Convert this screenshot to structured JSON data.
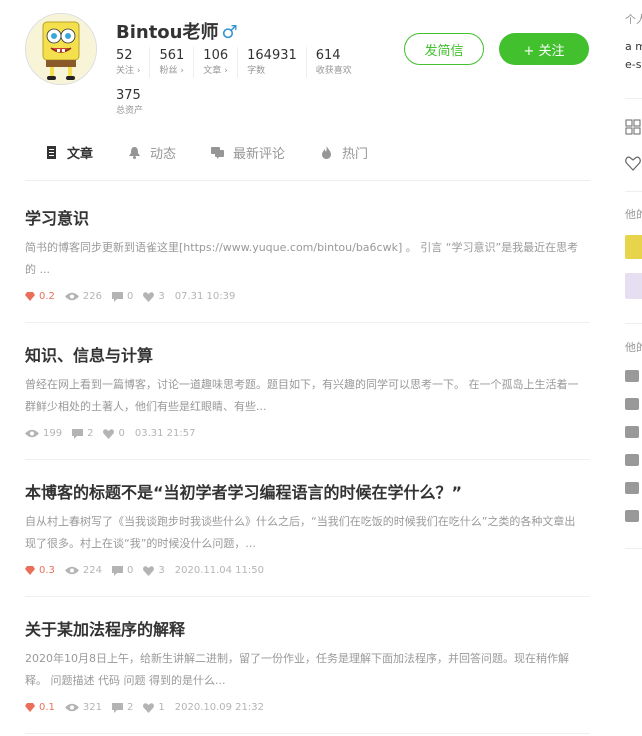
{
  "profile": {
    "name": "Bintou老师",
    "gender_icon": "♂",
    "stats": [
      {
        "num": "52",
        "label": "关注 ›"
      },
      {
        "num": "561",
        "label": "粉丝 ›"
      },
      {
        "num": "106",
        "label": "文章 ›"
      },
      {
        "num": "164931",
        "label": "字数"
      },
      {
        "num": "614",
        "label": "收获喜欢"
      }
    ],
    "assets": {
      "num": "375",
      "label": "总资产"
    },
    "message_button": "发简信",
    "follow_button": "+ 关注"
  },
  "tabs": [
    {
      "label": "文章",
      "icon": "article-icon",
      "active": true
    },
    {
      "label": "动态",
      "icon": "bell-icon"
    },
    {
      "label": "最新评论",
      "icon": "comment-icon"
    },
    {
      "label": "热门",
      "icon": "fire-icon"
    }
  ],
  "articles": [
    {
      "title": "学习意识",
      "abstract": "简书的博客同步更新到语雀这里[https://www.yuque.com/bintou/ba6cwk] 。 引言 “学习意识”是我最近在思考的 ...",
      "diamond": "0.2",
      "views": "226",
      "comments": "0",
      "likes": "3",
      "time": "07.31 10:39"
    },
    {
      "title": "知识、信息与计算",
      "abstract": "曾经在网上看到一篇博客，讨论一道趣味思考题。题目如下，有兴趣的同学可以思考一下。 在一个孤岛上生活着一群鲜少相处的土著人，他们有些是红眼睛、有些...",
      "views": "199",
      "comments": "2",
      "likes": "0",
      "time": "03.31 21:57"
    },
    {
      "title": "本博客的标题不是“当初学者学习编程语言的时候在学什么？”",
      "abstract": "自从村上春树写了《当我谈跑步时我谈些什么》什么之后，“当我们在吃饭的时候我们在吃什么”之类的各种文章出现了很多。村上在谈“我”的时候没什么问题，...",
      "diamond": "0.3",
      "views": "224",
      "comments": "0",
      "likes": "3",
      "time": "2020.11.04 11:50"
    },
    {
      "title": "关于某加法程序的解释",
      "abstract": "2020年10月8日上午，给新生讲解二进制，留了一份作业，任务是理解下面加法程序，并回答问题。现在稍作解释。 问题描述 代码 问题 得到的是什么...",
      "diamond": "0.1",
      "views": "321",
      "comments": "2",
      "likes": "1",
      "time": "2020.10.09 21:32"
    }
  ],
  "sidebar": {
    "intro_title": "个人",
    "intro_text1": "a m",
    "intro_text2": "e-s",
    "his_label1": "他的",
    "his_label2": "他的"
  },
  "colors": {
    "accent": "#42c02e",
    "diamond": "#ea6f5a",
    "muted": "#969696"
  }
}
